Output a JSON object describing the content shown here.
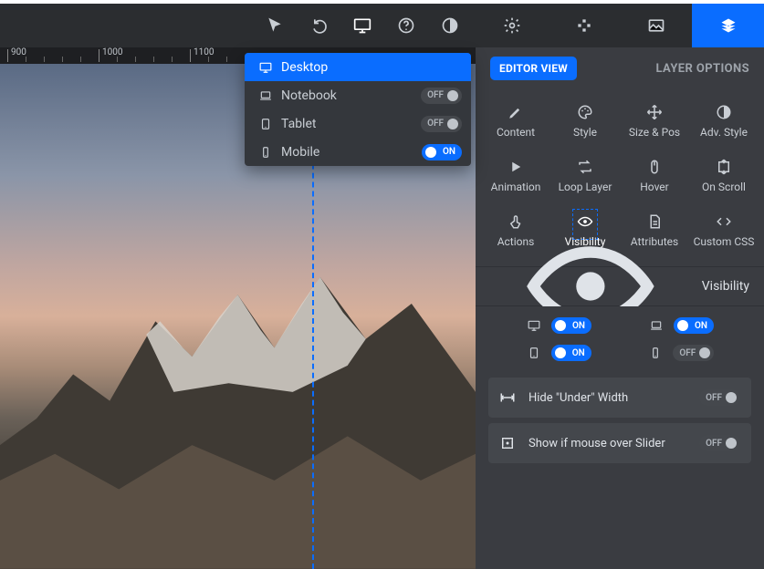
{
  "ruler": {
    "marks": [
      "900",
      "1000",
      "1100"
    ]
  },
  "toolbar": {
    "active": "viewport"
  },
  "viewport_menu": {
    "items": [
      {
        "label": "Desktop",
        "icon": "desktop",
        "active": true,
        "toggle": null
      },
      {
        "label": "Notebook",
        "icon": "laptop",
        "active": false,
        "toggle": "OFF"
      },
      {
        "label": "Tablet",
        "icon": "tablet",
        "active": false,
        "toggle": "OFF"
      },
      {
        "label": "Mobile",
        "icon": "mobile",
        "active": false,
        "toggle": "ON"
      }
    ]
  },
  "panel": {
    "badge": "EDITOR VIEW",
    "layer_options": "LAYER OPTIONS",
    "tabs_active": "layers",
    "grid": [
      {
        "label": "Content",
        "icon": "pencil"
      },
      {
        "label": "Style",
        "icon": "palette"
      },
      {
        "label": "Size & Pos",
        "icon": "move"
      },
      {
        "label": "Adv. Style",
        "icon": "contrast"
      },
      {
        "label": "Animation",
        "icon": "play"
      },
      {
        "label": "Loop Layer",
        "icon": "loop"
      },
      {
        "label": "Hover",
        "icon": "mouse"
      },
      {
        "label": "On Scroll",
        "icon": "scroll"
      },
      {
        "label": "Actions",
        "icon": "tap"
      },
      {
        "label": "Visibility",
        "icon": "eye",
        "active": true
      },
      {
        "label": "Attributes",
        "icon": "doc"
      },
      {
        "label": "Custom CSS",
        "icon": "code"
      }
    ],
    "section_title": "Visibility",
    "visibility": {
      "desktop": "ON",
      "laptop": "ON",
      "tablet": "ON",
      "mobile": "OFF"
    },
    "options": [
      {
        "label": "Hide \"Under\" Width",
        "icon": "width",
        "toggle": "OFF"
      },
      {
        "label": "Show if mouse over Slider",
        "icon": "target",
        "toggle": "OFF"
      }
    ]
  },
  "labels": {
    "on": "ON",
    "off": "OFF"
  }
}
